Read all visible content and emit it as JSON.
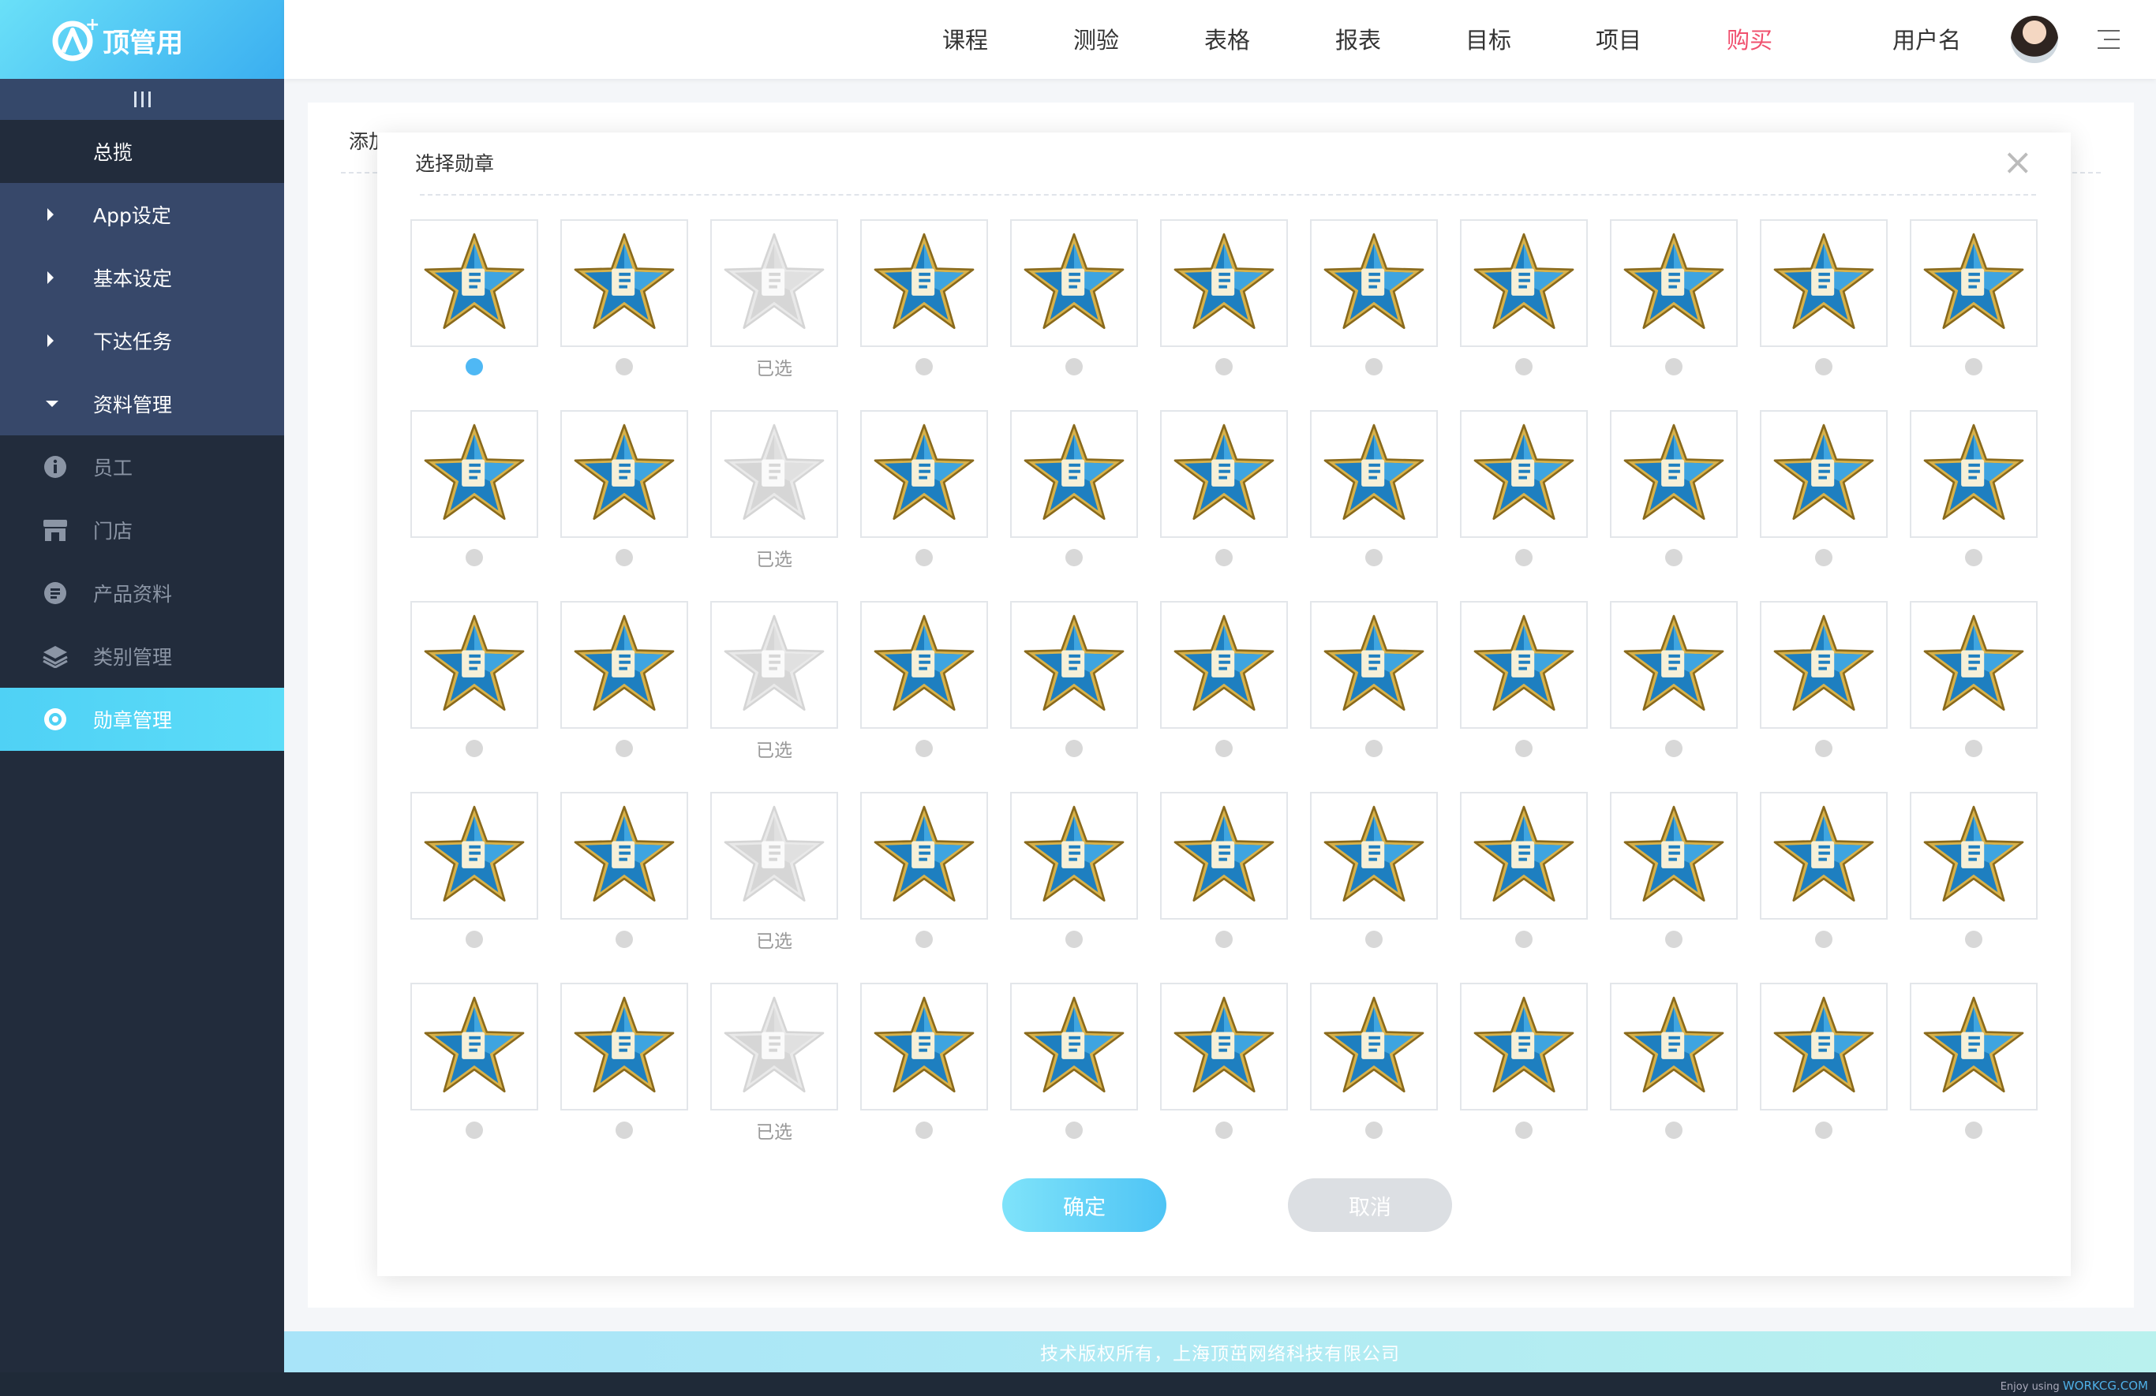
{
  "brand": {
    "logo_text": "顶管用",
    "accent": "#4fd1f5"
  },
  "header": {
    "nav": [
      {
        "label": "课程"
      },
      {
        "label": "测验"
      },
      {
        "label": "表格"
      },
      {
        "label": "报表"
      },
      {
        "label": "目标"
      },
      {
        "label": "项目"
      },
      {
        "label": "购买",
        "active": true
      }
    ],
    "user_name": "用户名"
  },
  "sidebar": {
    "overview": "总揽",
    "groups": [
      {
        "label": "App设定",
        "expanded": false
      },
      {
        "label": "基本设定",
        "expanded": false
      },
      {
        "label": "下达任务",
        "expanded": false
      },
      {
        "label": "资料管理",
        "expanded": true
      }
    ],
    "sub_items": [
      {
        "label": "员工",
        "icon": "info-icon"
      },
      {
        "label": "门店",
        "icon": "store-icon"
      },
      {
        "label": "产品资料",
        "icon": "document-icon"
      },
      {
        "label": "类别管理",
        "icon": "layers-icon"
      },
      {
        "label": "勋章管理",
        "icon": "medal-icon",
        "active": true
      }
    ]
  },
  "content": {
    "title": "添加"
  },
  "modal": {
    "title": "选择勋章",
    "close_icon": "close-icon",
    "picked_label": "已选",
    "grid": {
      "rows": 5,
      "columns": 11,
      "picked_column": 3,
      "selected": {
        "row": 1,
        "column": 1
      }
    },
    "confirm": "确定",
    "cancel": "取消"
  },
  "footer": {
    "copyright": "技术版权所有，上海顶茁网络科技有限公司"
  },
  "watermark": {
    "prefix": "Enjoy using",
    "site": "WORKCG.COM"
  }
}
